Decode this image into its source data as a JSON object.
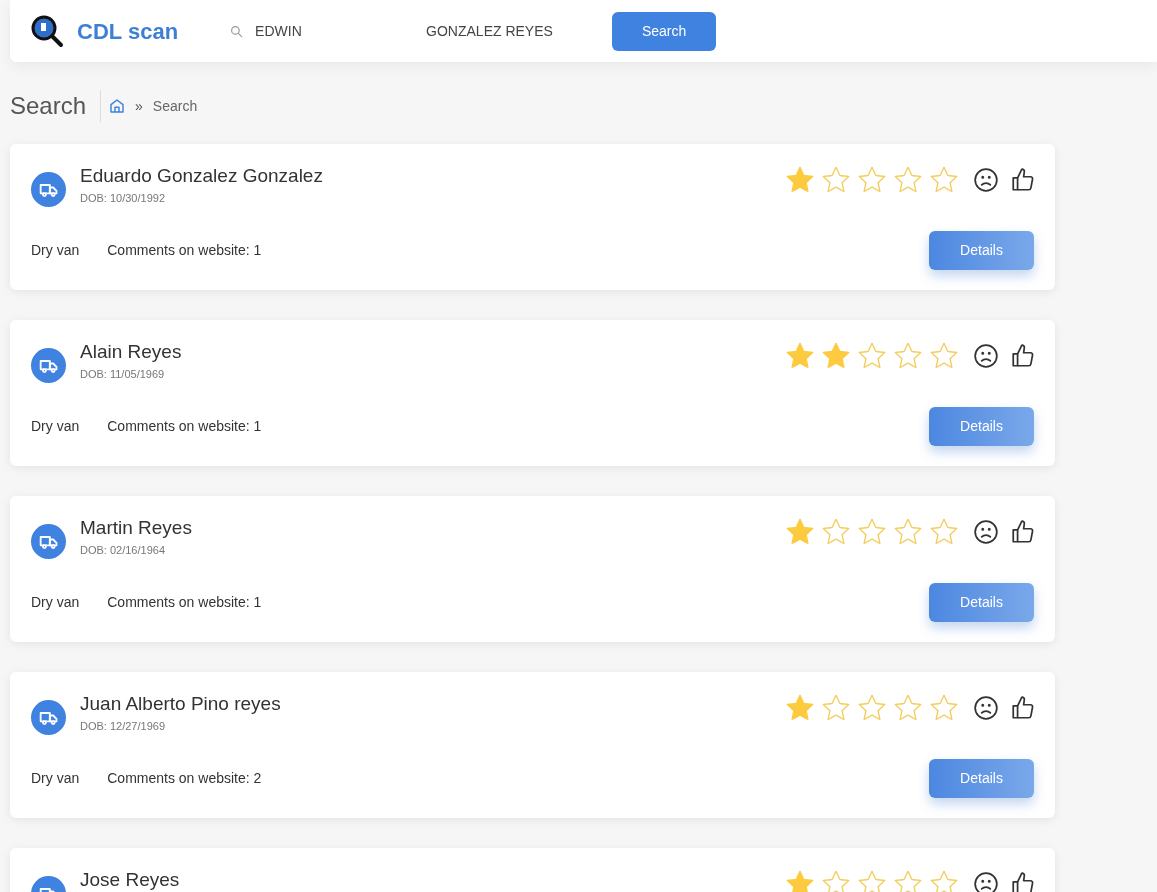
{
  "header": {
    "brand": "CDL scan",
    "first_name": {
      "value": "EDWIN"
    },
    "last_name": {
      "value": "GONZALEZ REYES"
    },
    "search_button": "Search"
  },
  "page_title": "Search",
  "breadcrumb": {
    "current": "Search",
    "separator": "»"
  },
  "results": [
    {
      "name": "Eduardo Gonzalez Gonzalez",
      "dob": "DOB: 10/30/1992",
      "stars": 1,
      "trailer": "Dry van",
      "comments": "Comments on website: 1",
      "button": "Details"
    },
    {
      "name": "Alain Reyes",
      "dob": "DOB: 11/05/1969",
      "stars": 2,
      "trailer": "Dry van",
      "comments": "Comments on website: 1",
      "button": "Details"
    },
    {
      "name": "Martin Reyes",
      "dob": "DOB: 02/16/1964",
      "stars": 1,
      "trailer": "Dry van",
      "comments": "Comments on website: 1",
      "button": "Details"
    },
    {
      "name": "Juan Alberto Pino reyes",
      "dob": "DOB: 12/27/1969",
      "stars": 1,
      "trailer": "Dry van",
      "comments": "Comments on website: 2",
      "button": "Details"
    },
    {
      "name": "Jose Reyes",
      "stars": 1
    }
  ]
}
